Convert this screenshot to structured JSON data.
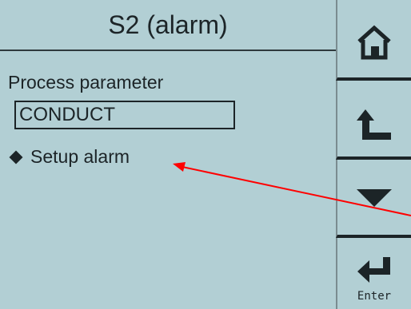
{
  "screen": {
    "title": "S2 (alarm)",
    "parameter_label": "Process parameter",
    "parameter_value": "CONDUCT",
    "menu_item": "Setup alarm"
  },
  "softkeys": [
    {
      "name": "home",
      "icon": "home-icon"
    },
    {
      "name": "back",
      "icon": "back-arrow-icon"
    },
    {
      "name": "down",
      "icon": "down-triangle-icon"
    },
    {
      "name": "enter",
      "icon": "enter-icon",
      "label": "Enter"
    }
  ],
  "annotation": {
    "color": "#ff0000"
  },
  "colors": {
    "screen_bg": "#b2cfd4",
    "text": "#1c2427"
  }
}
